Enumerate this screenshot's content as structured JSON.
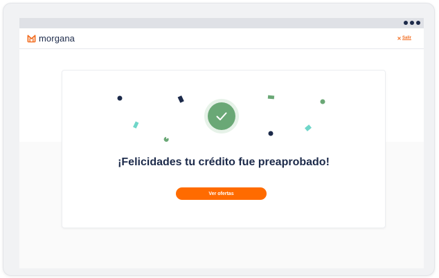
{
  "brand": {
    "name": "morgana",
    "accent_color": "#f26b1d",
    "text_color": "#1c2a4a"
  },
  "header": {
    "exit_label": "Salir",
    "exit_icon": "close-icon"
  },
  "window_controls": {
    "menu_icon": "more-dots-icon"
  },
  "success": {
    "icon": "check-icon",
    "icon_color": "#6aa876",
    "title": "¡Felicidades tu crédito fue preaprobado!",
    "cta_label": "Ver ofertas",
    "cta_color": "#ff6b00"
  },
  "confetti_colors": {
    "navy": "#1c2a4a",
    "green": "#6aa876",
    "teal": "#6fd6c9"
  }
}
